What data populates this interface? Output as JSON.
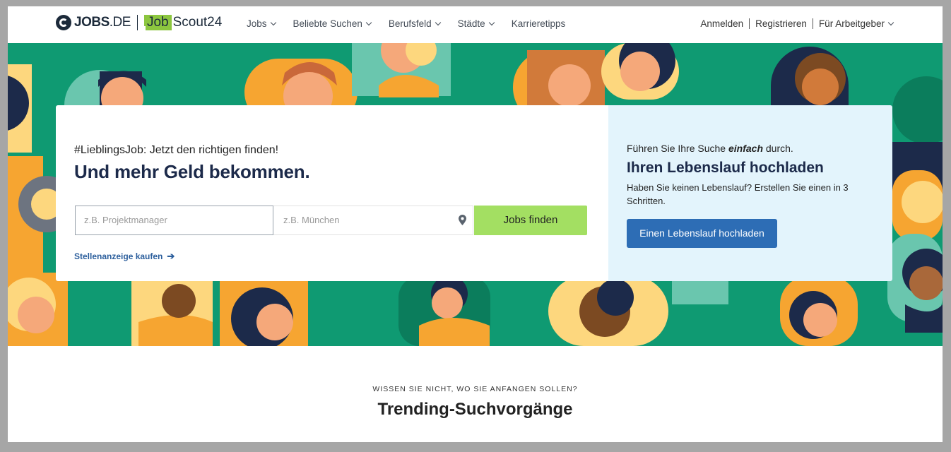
{
  "brand": {
    "logo_main": "JOBS",
    "logo_suffix": ".DE",
    "partner_box": "Job",
    "partner_rest": "Scout24"
  },
  "nav": {
    "items": [
      "Jobs",
      "Beliebte Suchen",
      "Berufsfeld",
      "Städte",
      "Karrieretipps"
    ],
    "login": "Anmelden",
    "register": "Registrieren",
    "employers": "Für Arbeitgeber"
  },
  "search": {
    "tagline": "#LieblingsJob: Jetzt den richtigen finden!",
    "headline": "Und mehr Geld bekommen.",
    "what_placeholder": "z.B. Projektmanager",
    "where_placeholder": "z.B. München",
    "button": "Jobs finden",
    "buy_link": "Stellenanzeige kaufen"
  },
  "cv": {
    "lead_before": "Führen Sie Ihre Suche ",
    "lead_emphasis": "einfach",
    "lead_after": " durch.",
    "title": "Ihren Lebenslauf hochladen",
    "subtitle": "Haben Sie keinen Lebenslauf? Erstellen Sie einen in 3 Schritten.",
    "button": "Einen Lebenslauf hochladen"
  },
  "trending": {
    "kicker": "WISSEN SIE NICHT, WO SIE ANFANGEN SOLLEN?",
    "title": "Trending-Suchvorgänge"
  },
  "colors": {
    "hero_green": "#0f9a72",
    "find_button": "#a3df62",
    "cv_button": "#2d6db5",
    "cv_panel": "#e3f4fc"
  }
}
